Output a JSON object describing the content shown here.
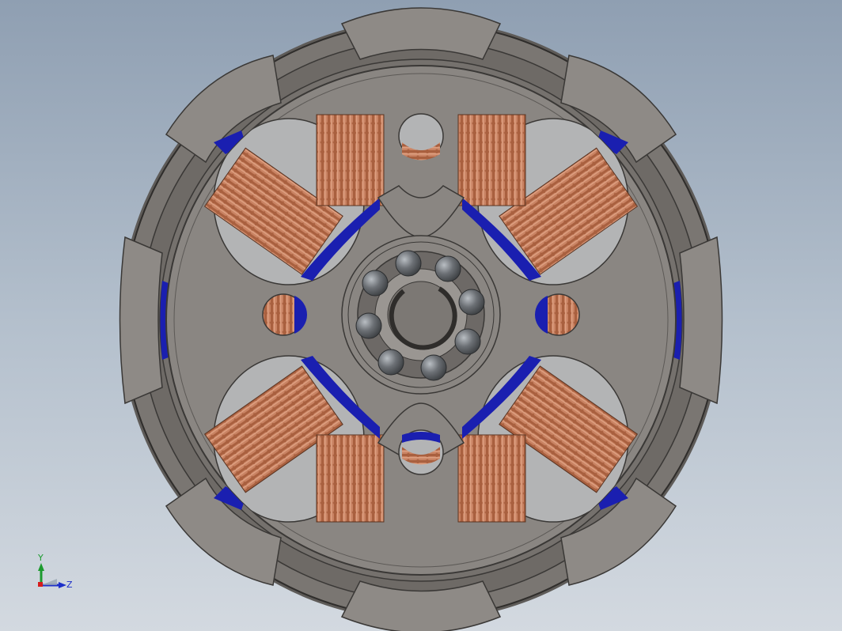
{
  "scene": {
    "model": "brushless-outrunner-motor",
    "view": "front"
  },
  "triad": {
    "y_label": "Y",
    "z_label": "Z"
  },
  "colors": {
    "background_top": "#8f9fb2",
    "background_bottom": "#d3d9e0",
    "housing": "#7e7a76",
    "housing_dark": "#55524f",
    "endcap": "#8d8985",
    "winding": "#b8714f",
    "magnet": "#1a1fb0",
    "bearing_ball": "#5b5f63",
    "axis_y": "#1c9a2e",
    "axis_z": "#1c2fc9"
  }
}
